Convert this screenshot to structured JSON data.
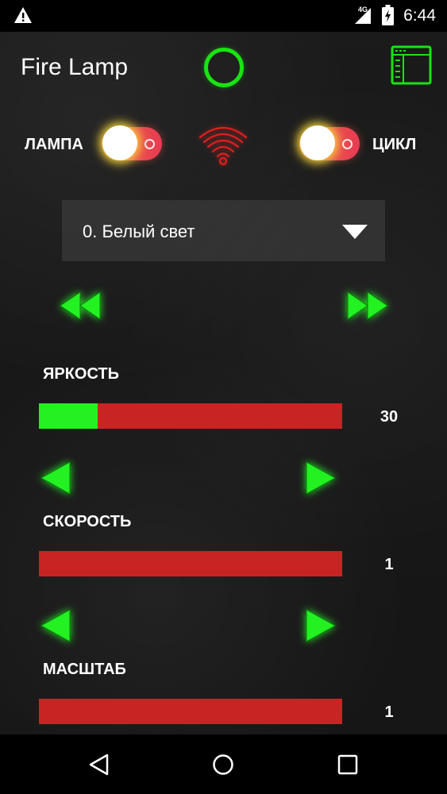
{
  "status_bar": {
    "time": "6:44",
    "network": "4G",
    "icons": [
      "warning-icon",
      "signal-icon",
      "battery-icon"
    ]
  },
  "header": {
    "title": "Fire Lamp",
    "status_icon": "ring-indicator-icon",
    "menu_icon": "window-menu-icon"
  },
  "toggles": {
    "lamp": {
      "label": "ЛАМПА"
    },
    "cycle": {
      "label": "ЦИКЛ"
    },
    "center_icon": "wifi-icon"
  },
  "mode_select": {
    "selected": "0. Белый свет"
  },
  "sliders": [
    {
      "label": "ЯРКОСТЬ",
      "value": "30",
      "fill_fraction": 0.195
    },
    {
      "label": "СКОРОСТЬ",
      "value": "1",
      "fill_fraction": 0
    },
    {
      "label": "МАСШТАБ",
      "value": "1",
      "fill_fraction": 0
    }
  ],
  "colors": {
    "accent_green": "#23f122",
    "track_red": "#c82424",
    "toggle_knob_glow": "#ffeb3c",
    "wifi_red": "#e01e1e"
  }
}
